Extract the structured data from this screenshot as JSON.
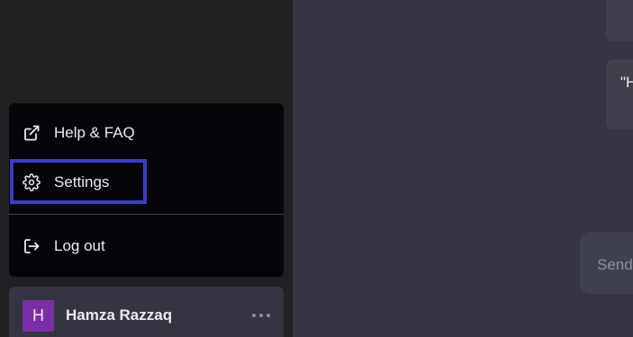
{
  "chat": {
    "message_snippet": "\"H",
    "composer_placeholder": "Send"
  },
  "menu": {
    "items": [
      {
        "label": "Help & FAQ",
        "icon": "external-link-icon"
      },
      {
        "label": "Settings",
        "icon": "gear-icon"
      },
      {
        "label": "Log out",
        "icon": "logout-icon"
      }
    ]
  },
  "user": {
    "avatar_initial": "H",
    "name": "Hamza Razzaq",
    "more_icon": "ellipsis-icon"
  },
  "colors": {
    "sidebar_bg": "#202123",
    "menu_bg": "#050509",
    "main_bg": "#343541",
    "highlight": "#3a3fc1",
    "avatar_bg": "#7a2fa6"
  }
}
